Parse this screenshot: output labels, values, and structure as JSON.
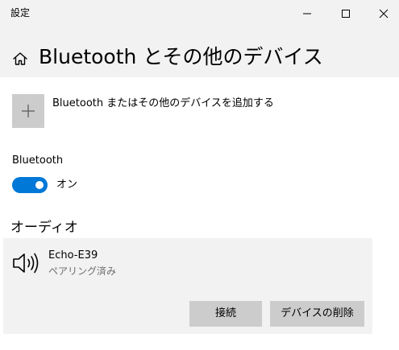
{
  "window": {
    "title": "設定",
    "controls": [
      "minimize-icon",
      "maximize-icon",
      "close-icon"
    ]
  },
  "header": {
    "home_icon": "home-icon",
    "title": "Bluetooth とその他のデバイス"
  },
  "add_device": {
    "icon": "plus-icon",
    "label": "Bluetooth またはその他のデバイスを追加する"
  },
  "bluetooth": {
    "label": "Bluetooth",
    "toggle_on": true,
    "state_label": "オン",
    "accent_color": "#0078d7"
  },
  "audio": {
    "heading": "オーディオ",
    "devices": [
      {
        "icon": "speaker-icon",
        "name": "Echo-E39",
        "status": "ペアリング済み",
        "buttons": {
          "connect": "接続",
          "remove": "デバイスの削除"
        }
      }
    ]
  }
}
